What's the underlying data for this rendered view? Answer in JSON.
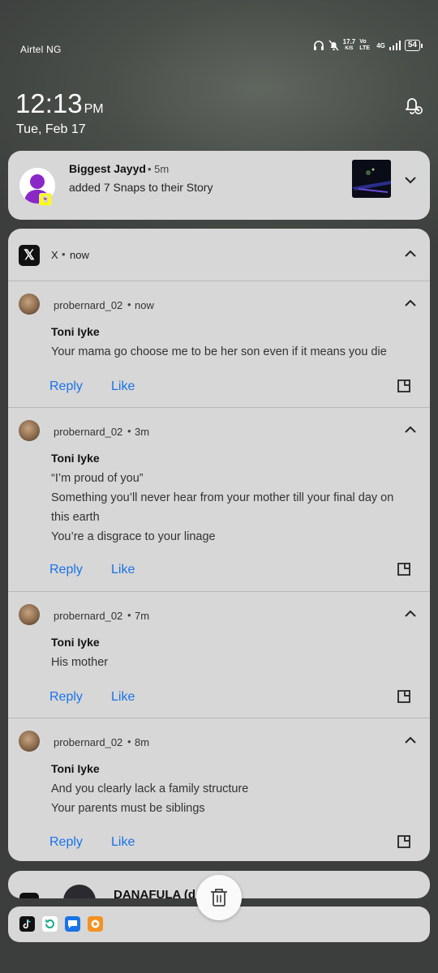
{
  "status_bar": {
    "carrier": "Airtel NG",
    "net_speed_value": "17.7",
    "net_speed_unit": "K/S",
    "volte": "Vo LTE",
    "network": "4G",
    "battery": "54"
  },
  "lockscreen": {
    "time": "12:13",
    "ampm": "PM",
    "date": "Tue, Feb 17"
  },
  "snap_notification": {
    "sender": "Biggest Jayyd",
    "time": "• 5m",
    "text": "added 7 Snaps to their Story"
  },
  "x_group": {
    "app": "X",
    "sep": "•",
    "time": "now",
    "messages": [
      {
        "handle": "probernard_02",
        "sep": "•",
        "time": "now",
        "name": "Toni Iyke",
        "lines": [
          "Your mama go choose me to be her son even if it means you die"
        ],
        "reply": "Reply",
        "like": "Like"
      },
      {
        "handle": "probernard_02",
        "sep": "•",
        "time": "3m",
        "name": "Toni Iyke",
        "lines": [
          "“I’m proud of you”",
          "Something you’ll never hear from your mother till your final day on",
          "this earth",
          "You’re a disgrace to your linage"
        ],
        "reply": "Reply",
        "like": "Like"
      },
      {
        "handle": "probernard_02",
        "sep": "•",
        "time": "7m",
        "name": "Toni Iyke",
        "lines": [
          "His mother"
        ],
        "reply": "Reply",
        "like": "Like"
      },
      {
        "handle": "probernard_02",
        "sep": "•",
        "time": "8m",
        "name": "Toni Iyke",
        "lines": [
          "And you clearly lack a family structure",
          "Your parents must be siblings"
        ],
        "reply": "Reply",
        "like": "Like"
      }
    ]
  },
  "partial_notification": {
    "name": "DANAFULA (d"
  },
  "tray_icons": [
    "tiktok-icon",
    "refresh-app-icon",
    "messages-icon",
    "orange-app-icon"
  ],
  "colors": {
    "accent": "#1a73e8",
    "card_bg": "#d7d7d7"
  }
}
